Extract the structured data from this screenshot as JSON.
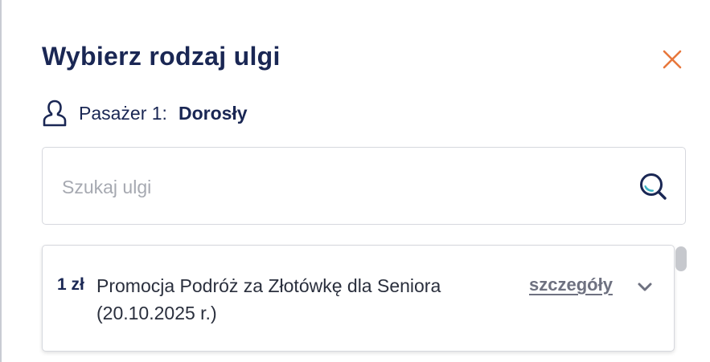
{
  "dialog": {
    "title": "Wybierz rodzaj ulgi",
    "close_icon": "close-x-icon",
    "close_color": "#e8773b"
  },
  "passenger": {
    "icon": "person-icon",
    "label": "Pasażer 1:",
    "type": "Dorosły"
  },
  "search": {
    "placeholder": "Szukaj ulgi",
    "value": "",
    "icon": "search-icon"
  },
  "discounts": [
    {
      "price": "1 zł",
      "name": "Promocja Podróż za Złotówkę dla Seniora (20.10.2025 r.)",
      "details_label": "szczegóły",
      "expand_icon": "chevron-down-icon"
    }
  ],
  "colors": {
    "primary_text": "#1a2754",
    "accent": "#e8773b",
    "link": "#6e7180",
    "border": "#d6d8de"
  }
}
